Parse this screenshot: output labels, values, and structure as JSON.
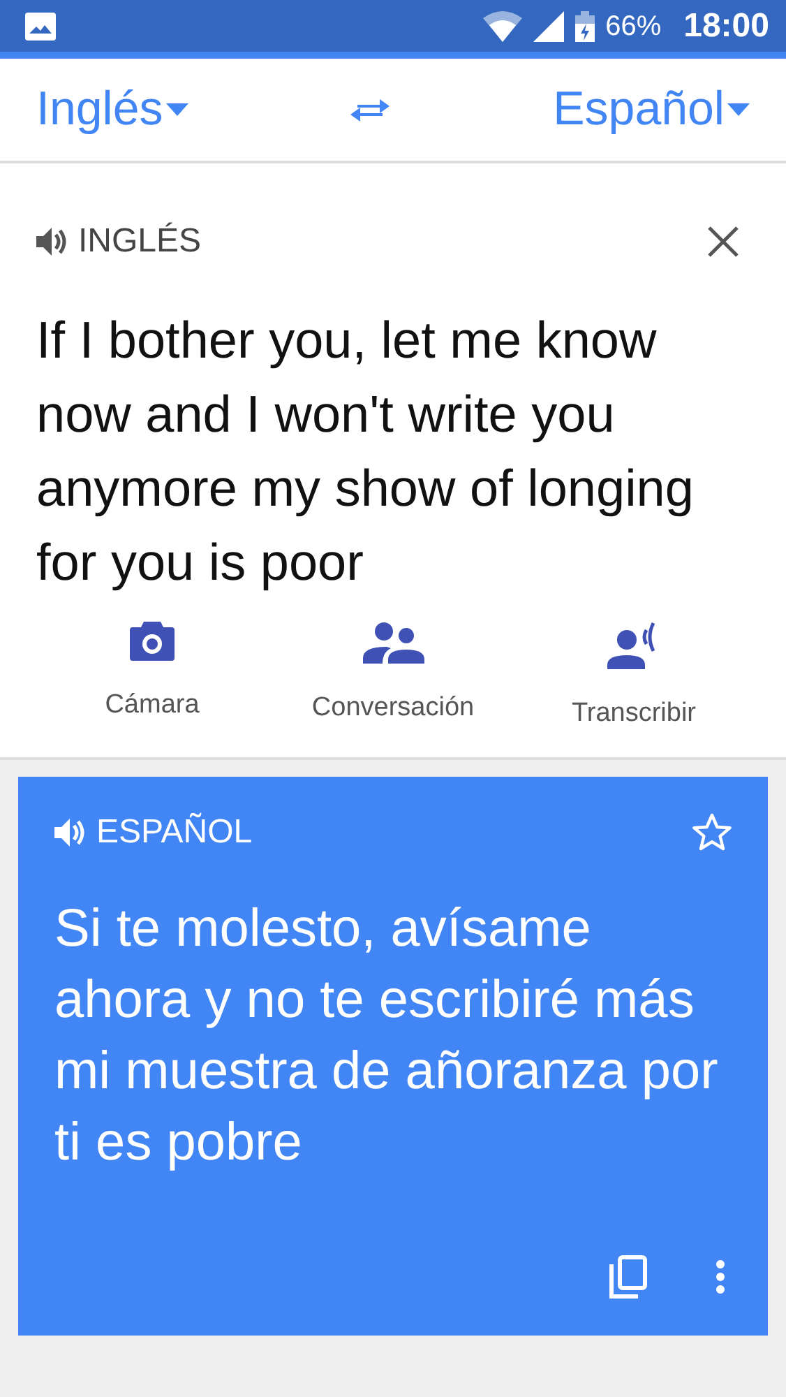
{
  "status_bar": {
    "battery": "66%",
    "time": "18:00"
  },
  "language_bar": {
    "source": "Inglés",
    "target": "Español"
  },
  "source": {
    "language": "INGLÉS",
    "text": "If I bother you, let me know now and I won't write you anymore my show of longing for you is poor"
  },
  "actions": [
    {
      "kind": "camera",
      "label": "Cámara"
    },
    {
      "kind": "conversation",
      "label": "Conversación"
    },
    {
      "kind": "transcribe",
      "label": "Transcribir"
    }
  ],
  "translation": {
    "language": "ESPAÑOL",
    "text": "Si te molesto, avísame ahora y no te escribiré más mi muestra de añoranza por ti es pobre",
    "starred": false
  }
}
